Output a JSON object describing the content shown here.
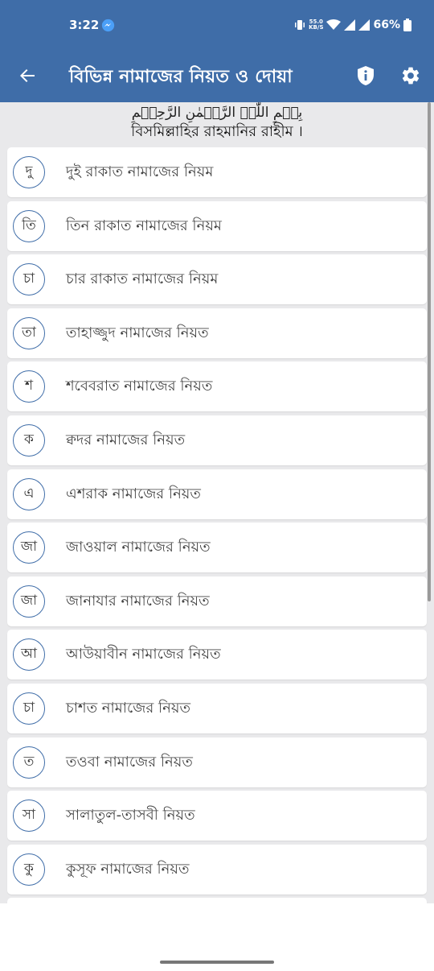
{
  "status_bar": {
    "time": "3:22",
    "speed_value": "55.0",
    "speed_unit": "KB/S",
    "battery": "66%"
  },
  "toolbar": {
    "title": "বিভিন্ন নামাজের নিয়ত ও দোয়া"
  },
  "header": {
    "arabic": "بِسۡمِ اللّٰہِ الرَّحۡمٰنِ الرَّحِیۡمِ",
    "bangla": "বিসমিল্লাহির রাহমানির রাহীম ।"
  },
  "colors": {
    "primary": "#3f6da8",
    "background": "#e9e9eb",
    "card": "#ffffff"
  },
  "items": [
    {
      "badge": "দু",
      "label": "দুই রাকাত নামাজের নিয়ম"
    },
    {
      "badge": "তি",
      "label": "তিন রাকাত নামাজের নিয়ম"
    },
    {
      "badge": "চা",
      "label": "চার রাকাত নামাজের নিয়ম"
    },
    {
      "badge": "তা",
      "label": "তাহাজ্জুদ নামাজের নিয়ত"
    },
    {
      "badge": "শ",
      "label": "শবেবরাত নামাজের নিয়ত"
    },
    {
      "badge": "ক",
      "label": " ক্বদর নামাজের নিয়ত"
    },
    {
      "badge": "এ",
      "label": "এশরাক নামাজের নিয়ত"
    },
    {
      "badge": "জা",
      "label": "জাওয়াল নামাজের নিয়ত"
    },
    {
      "badge": "জা",
      "label": "জানাযার নামাজের নিয়ত"
    },
    {
      "badge": "আ",
      "label": "আউয়াবীন নামাজের নিয়ত"
    },
    {
      "badge": "চা",
      "label": "চাশত নামাজের নিয়ত"
    },
    {
      "badge": "ত",
      "label": "তওবা নামাজের নিয়ত"
    },
    {
      "badge": "সা",
      "label": "সালাতুল-তাসবী নিয়ত"
    },
    {
      "badge": "কু",
      "label": "কুসূফ নামাজের নিয়ত"
    },
    {
      "badge": "",
      "label": ""
    }
  ]
}
